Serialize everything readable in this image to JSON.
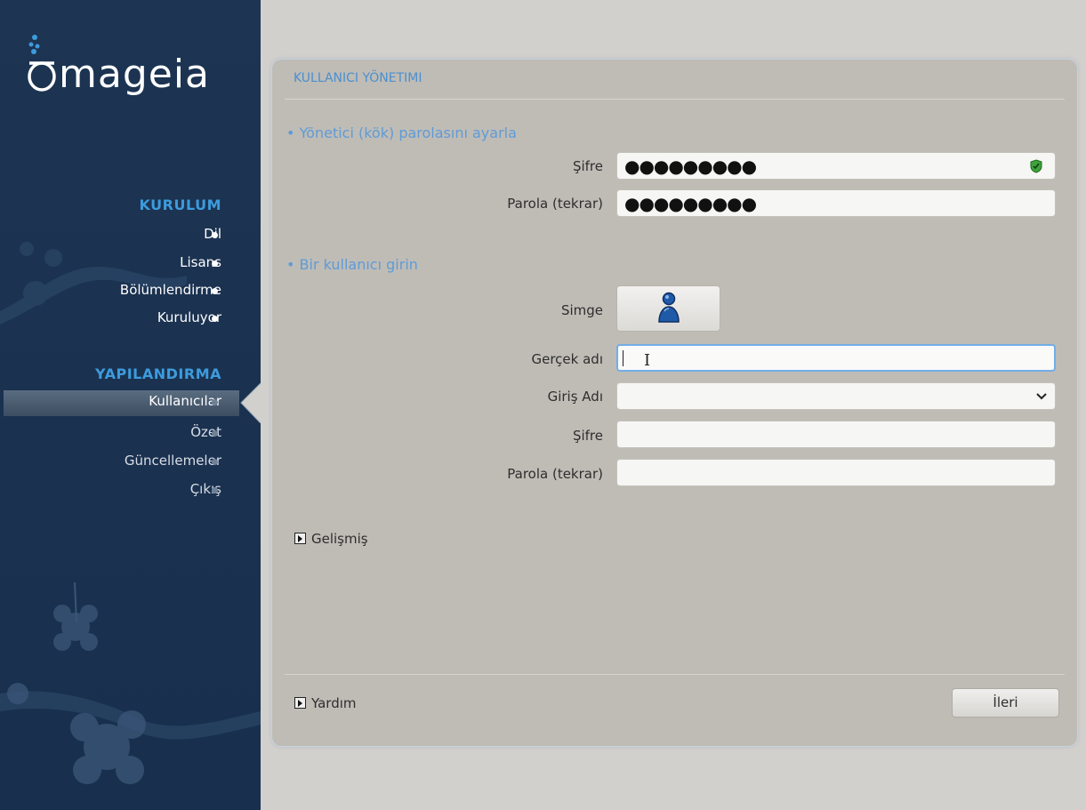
{
  "sidebar": {
    "logo_text": "mageia",
    "install_heading": "KURULUM",
    "install_steps": [
      {
        "label": "Dil",
        "done": true
      },
      {
        "label": "Lisans",
        "done": true
      },
      {
        "label": "Bölümlendirme",
        "done": true
      },
      {
        "label": "Kuruluyor",
        "done": true
      }
    ],
    "config_heading": "YAPILANDIRMA",
    "config_steps": [
      {
        "label": "Kullanıcılar",
        "active": true
      },
      {
        "label": "Özet"
      },
      {
        "label": "Güncellemeler"
      },
      {
        "label": "Çıkış"
      }
    ]
  },
  "panel": {
    "title": "KULLANICI YÖNETIMI",
    "root_section": "• Yönetici (kök) parolasını ayarla",
    "root_password_label": "Şifre",
    "root_password_value": "●●●●●●●●●",
    "root_password_repeat_label": "Parola (tekrar)",
    "root_password_repeat_value": "●●●●●●●●●",
    "user_section": "• Bir kullanıcı girin",
    "icon_label": "Simge",
    "real_name_label": "Gerçek adı",
    "real_name_value": "",
    "login_label": "Giriş Adı",
    "login_value": "",
    "user_password_label": "Şifre",
    "user_password_value": "",
    "user_password_repeat_label": "Parola (tekrar)",
    "user_password_repeat_value": "",
    "advanced_label": "Gelişmiş",
    "help_label": "Yardım",
    "next_label": "İleri"
  },
  "colors": {
    "sidebar_bg": "#1d3552",
    "heading_blue": "#3d9bdc",
    "panel_bg": "#bfbcb6",
    "section_blue": "#5f9bd7",
    "focus_ring": "#72aee6",
    "shield_green": "#3fa33c"
  }
}
